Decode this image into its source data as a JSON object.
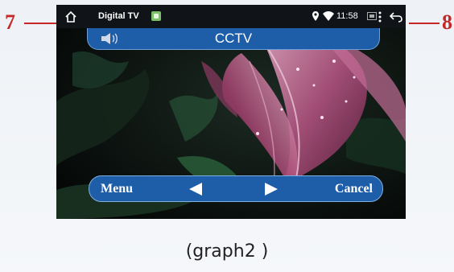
{
  "callouts": {
    "left": "7",
    "right": "8"
  },
  "statusbar": {
    "app_name": "Digital TV",
    "time": "11:58",
    "icons": [
      "home-icon",
      "app-badge-icon",
      "location-pin-icon",
      "wifi-icon",
      "cast-icon",
      "more-vert-icon",
      "back-icon"
    ]
  },
  "channel_bar": {
    "channel_name": "CCTV",
    "icon": "speaker-icon"
  },
  "control_bar": {
    "menu_label": "Menu",
    "cancel_label": "Cancel",
    "prev_icon": "prev-arrow-icon",
    "next_icon": "next-arrow-icon"
  },
  "caption": "(graph2 )",
  "colors": {
    "bar_blue": "#1e5da8",
    "callout_red": "#c62828"
  }
}
